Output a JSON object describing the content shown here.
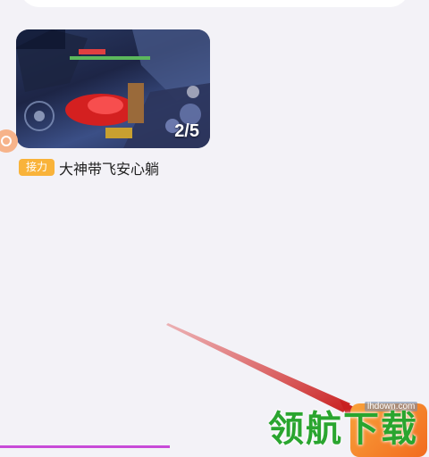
{
  "feed": {
    "item": {
      "page_counter": "2/5",
      "badge": "接力",
      "title": "大神带飞安心躺"
    }
  },
  "watermark": {
    "site_url": "lhdown.com",
    "text": "领航下载"
  },
  "colors": {
    "background": "#f3f2f7",
    "badge": "#f9b33a",
    "arrow": "#d8322c",
    "watermark": "#2aa52f",
    "fab": "#f48a2b"
  }
}
